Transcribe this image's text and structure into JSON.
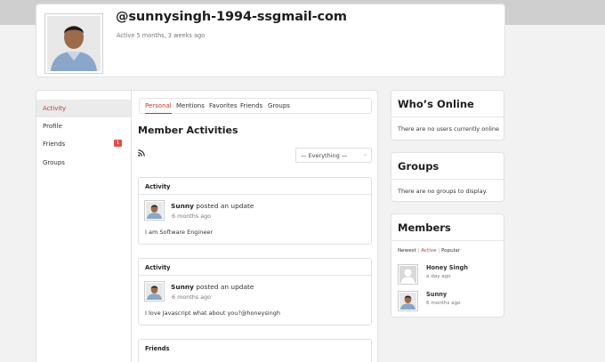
{
  "profile": {
    "username": "@sunnysingh-1994-ssgmail-com",
    "active_text": "Active 5 months, 3 weeks ago"
  },
  "nav": {
    "items": [
      {
        "label": "Activity"
      },
      {
        "label": "Profile"
      },
      {
        "label": "Friends",
        "count": "1"
      },
      {
        "label": "Groups"
      }
    ]
  },
  "tabs": [
    "Personal",
    "Mentions",
    "Favorites",
    "Friends",
    "Groups"
  ],
  "main": {
    "title": "Member Activities",
    "filter_selected": "— Everything —"
  },
  "feed": [
    {
      "header": "Activity",
      "name": "Sunny",
      "action": "posted an update",
      "time": "6 months ago",
      "body": "I am Software Engineer"
    },
    {
      "header": "Activity",
      "name": "Sunny",
      "action": "posted an update",
      "time": "6 months ago",
      "body": "I love Javascript what about you?@honeysingh"
    },
    {
      "header": "Friends"
    }
  ],
  "whos_online": {
    "title": "Who’s Online",
    "text": "There are no users currently online"
  },
  "groups_widget": {
    "title": "Groups",
    "text": "There are no groups to display."
  },
  "members": {
    "title": "Members",
    "filters": [
      "Newest",
      "Active",
      "Popular"
    ],
    "list": [
      {
        "name": "Honey Singh",
        "time": "a day ago"
      },
      {
        "name": "Sunny",
        "time": "6 months ago"
      }
    ]
  },
  "colors": {
    "accent": "#c0392b",
    "badge": "#e0504d",
    "background": "#f2f2f2"
  }
}
